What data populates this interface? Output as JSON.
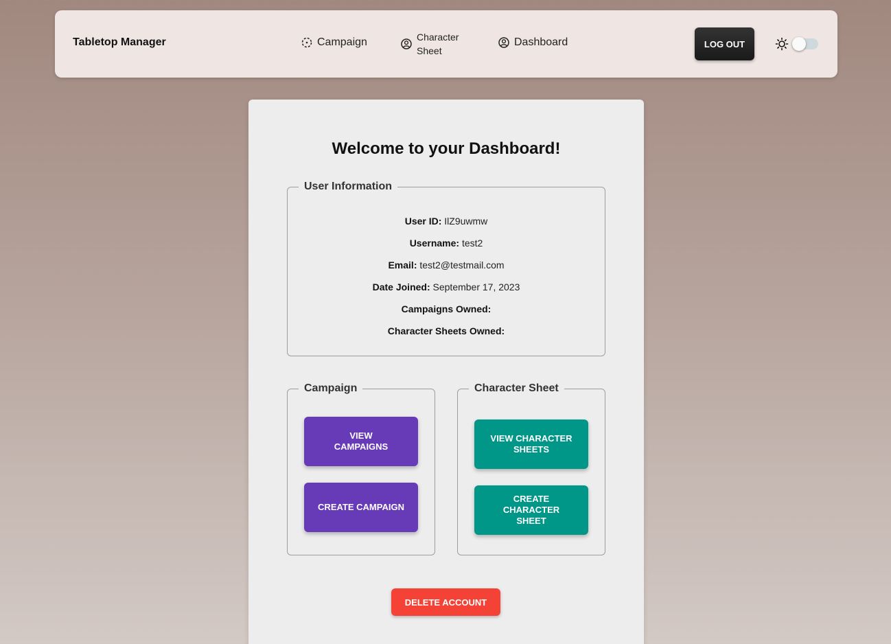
{
  "navbar": {
    "brand": "Tabletop Manager",
    "links": {
      "campaign": "Campaign",
      "character_sheet": "Character Sheet",
      "dashboard": "Dashboard"
    },
    "logout_label": "LOG OUT",
    "theme_icon": "sun-icon",
    "dark_mode_enabled": false
  },
  "dashboard": {
    "title": "Welcome to your Dashboard!",
    "user_info": {
      "legend": "User Information",
      "rows": [
        {
          "label": "User ID:",
          "value": "IlZ9uwmw"
        },
        {
          "label": "Username:",
          "value": "test2"
        },
        {
          "label": "Email:",
          "value": "test2@testmail.com"
        },
        {
          "label": "Date Joined:",
          "value": "September 17, 2023"
        },
        {
          "label": "Campaigns Owned:",
          "value": ""
        },
        {
          "label": "Character Sheets Owned:",
          "value": ""
        }
      ]
    },
    "campaign": {
      "legend": "Campaign",
      "view_label": "VIEW CAMPAIGNS",
      "create_label": "CREATE CAMPAIGN"
    },
    "character_sheet": {
      "legend": "Character Sheet",
      "view_label": "VIEW CHARACTER SHEETS",
      "create_label": "CREATE CHARACTER SHEET"
    },
    "delete_label": "DELETE ACCOUNT"
  },
  "colors": {
    "purple": "#673ab7",
    "teal": "#009688",
    "red": "#f44336",
    "dark": "#212121"
  }
}
